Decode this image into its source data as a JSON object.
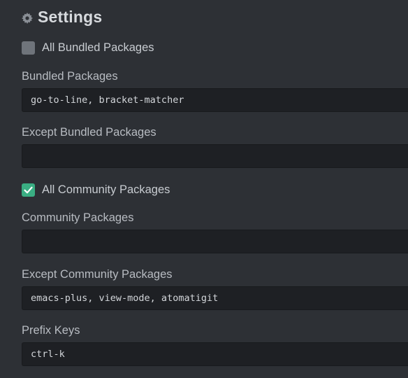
{
  "settings": {
    "title": "Settings",
    "icon": "gear-icon",
    "all_bundled": {
      "label": "All Bundled Packages",
      "checked": false
    },
    "bundled_packages": {
      "label": "Bundled Packages",
      "value": "go-to-line, bracket-matcher"
    },
    "except_bundled": {
      "label": "Except Bundled Packages",
      "value": ""
    },
    "all_community": {
      "label": "All Community Packages",
      "checked": true
    },
    "community_packages": {
      "label": "Community Packages",
      "value": ""
    },
    "except_community": {
      "label": "Except Community Packages",
      "value": "emacs-plus, view-mode, atomatigit"
    },
    "prefix_keys": {
      "label": "Prefix Keys",
      "value": "ctrl-k"
    }
  },
  "colors": {
    "background": "#2d3035",
    "input_background": "#1e2024",
    "checkbox_checked": "#3aae83",
    "checkbox_unchecked": "#6f747b"
  }
}
